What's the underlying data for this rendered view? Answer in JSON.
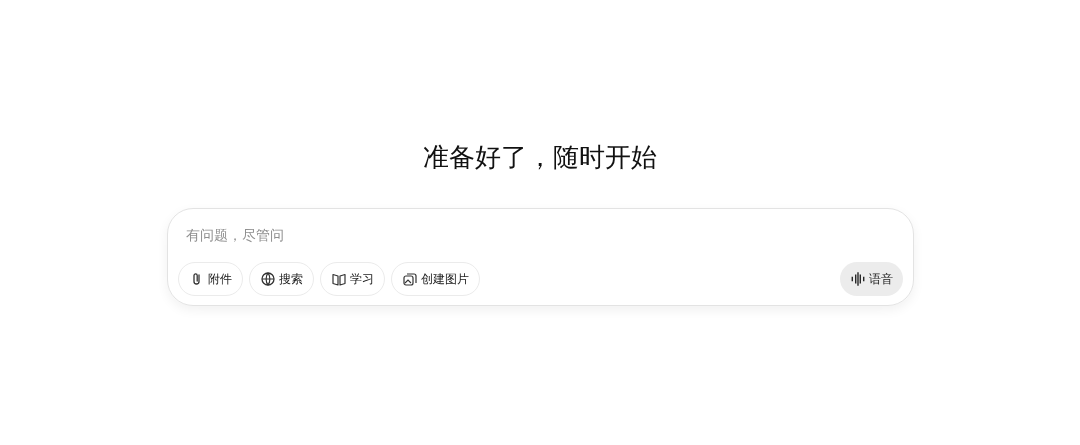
{
  "heading": "准备好了，随时开始",
  "composer": {
    "placeholder": "有问题，尽管问",
    "tools": [
      {
        "kind": "attach",
        "label": "附件"
      },
      {
        "kind": "search",
        "label": "搜索"
      },
      {
        "kind": "study",
        "label": "学习"
      },
      {
        "kind": "image",
        "label": "创建图片"
      }
    ],
    "voice_button": {
      "label": "语音"
    }
  }
}
